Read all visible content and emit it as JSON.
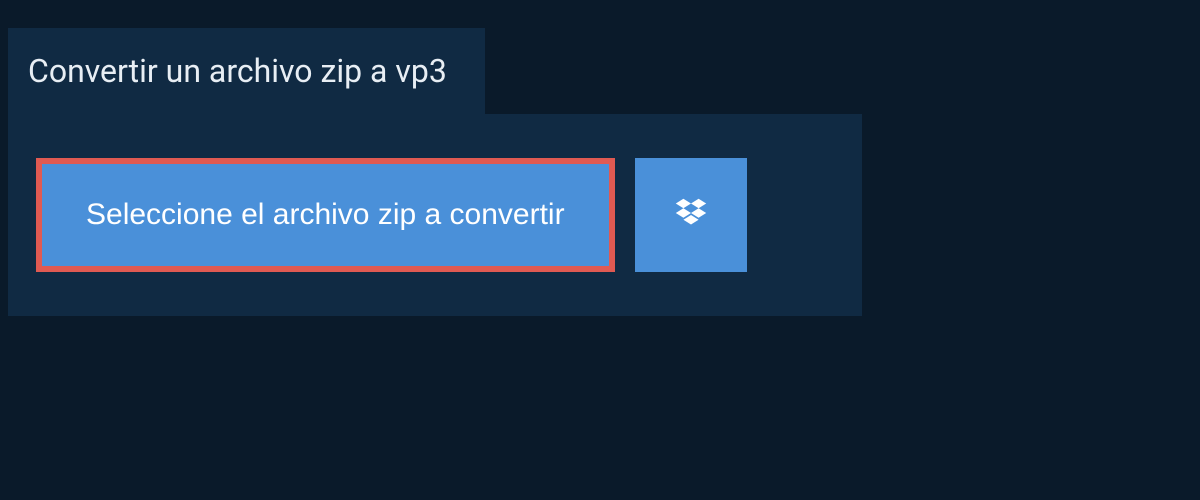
{
  "header": {
    "title": "Convertir un archivo zip a vp3"
  },
  "actions": {
    "select_label": "Seleccione el archivo zip a convertir",
    "dropbox_icon": "dropbox-icon"
  },
  "colors": {
    "page_bg": "#0a1a2a",
    "panel_bg": "#102a43",
    "button_bg": "#4a90d9",
    "highlight_border": "#e05a52",
    "text_light": "#e8eef4",
    "text_white": "#ffffff"
  }
}
